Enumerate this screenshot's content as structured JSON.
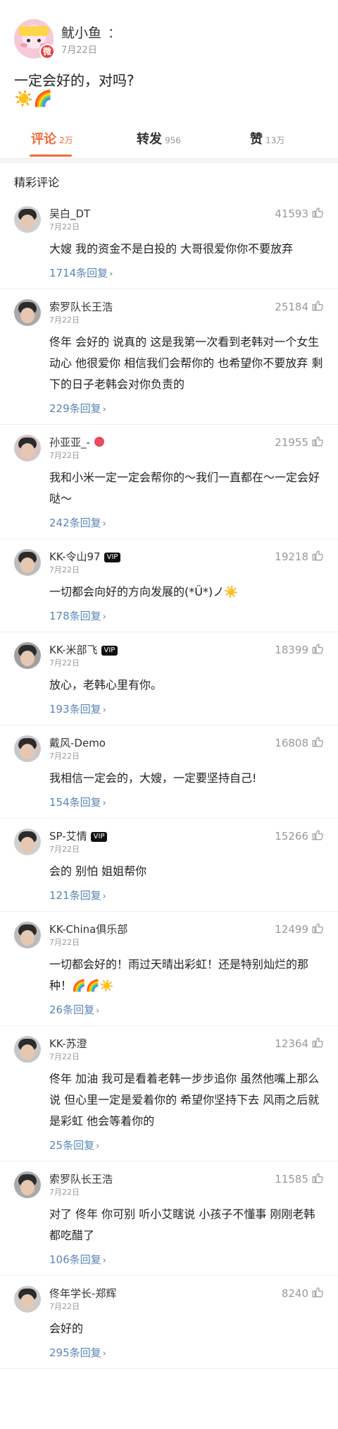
{
  "post": {
    "author": "鱿小鱼",
    "more_icon": "：",
    "date": "7月22日",
    "text": "一定会好的，对吗?",
    "emoji": "☀️🌈",
    "badge_text": "微"
  },
  "tabs": [
    {
      "label": "评论",
      "count": "2万",
      "active": true
    },
    {
      "label": "转发",
      "count": "956",
      "active": false
    },
    {
      "label": "赞",
      "count": "13万",
      "active": false
    }
  ],
  "section_title": "精彩评论",
  "comments": [
    {
      "name": "吴白_DT",
      "date": "7月22日",
      "likes": "41593",
      "text": "大嫂 我的资金不是白投的 大哥很爱你你不要放弃",
      "replies": "1714条回复",
      "badge": ""
    },
    {
      "name": "索罗队长王浩",
      "date": "7月22日",
      "likes": "25184",
      "text": "佟年  会好的  说真的  这是我第一次看到老韩对一个女生动心  他很爱你   相信我们会帮你的  也希望你不要放弃  剩下的日子老韩会对你负责的",
      "replies": "229条回复",
      "badge": ""
    },
    {
      "name": "孙亚亚_-",
      "date": "7月22日",
      "likes": "21955",
      "text": "我和小米一定一定会帮你的～我们一直都在～一定会好哒～",
      "replies": "242条回复",
      "badge": "red"
    },
    {
      "name": "KK-令山97",
      "date": "7月22日",
      "likes": "19218",
      "text": "一切都会向好的方向发展的(*Ü*)ノ☀️",
      "replies": "178条回复",
      "badge": "vip"
    },
    {
      "name": "KK-米部飞",
      "date": "7月22日",
      "likes": "18399",
      "text": "放心，老韩心里有你。",
      "replies": "193条回复",
      "badge": "vip"
    },
    {
      "name": "戴风-Demo",
      "date": "7月22日",
      "likes": "16808",
      "text": "我相信一定会的，大嫂，一定要坚持自己!",
      "replies": "154条回复",
      "badge": ""
    },
    {
      "name": "SP-艾情",
      "date": "7月22日",
      "likes": "15266",
      "text": "会的 别怕 姐姐帮你",
      "replies": "121条回复",
      "badge": "vip"
    },
    {
      "name": "KK-China俱乐部",
      "date": "7月22日",
      "likes": "12499",
      "text": "一切都会好的！雨过天晴出彩虹！还是特别灿烂的那种！🌈🌈☀️",
      "replies": "26条回复",
      "badge": ""
    },
    {
      "name": "KK-苏澄",
      "date": "7月22日",
      "likes": "12364",
      "text": "佟年  加油  我可是看着老韩一步步追你  虽然他嘴上那么说 但心里一定是爱着你的 希望你坚持下去  风雨之后就是彩虹 他会等着你的",
      "replies": "25条回复",
      "badge": ""
    },
    {
      "name": "索罗队长王浩",
      "date": "7月22日",
      "likes": "11585",
      "text": "对了  佟年  你可别  听小艾瞎说  小孩子不懂事  刚刚老韩都吃醋了",
      "replies": "106条回复",
      "badge": ""
    },
    {
      "name": "佟年学长-郑辉",
      "date": "7月22日",
      "likes": "8240",
      "text": "会好的",
      "replies": "295条回复",
      "badge": ""
    }
  ],
  "vip_label": "VIP",
  "reply_chevron": "›",
  "colors": {
    "accent": "#f06c3b",
    "link": "#5a86b8"
  }
}
